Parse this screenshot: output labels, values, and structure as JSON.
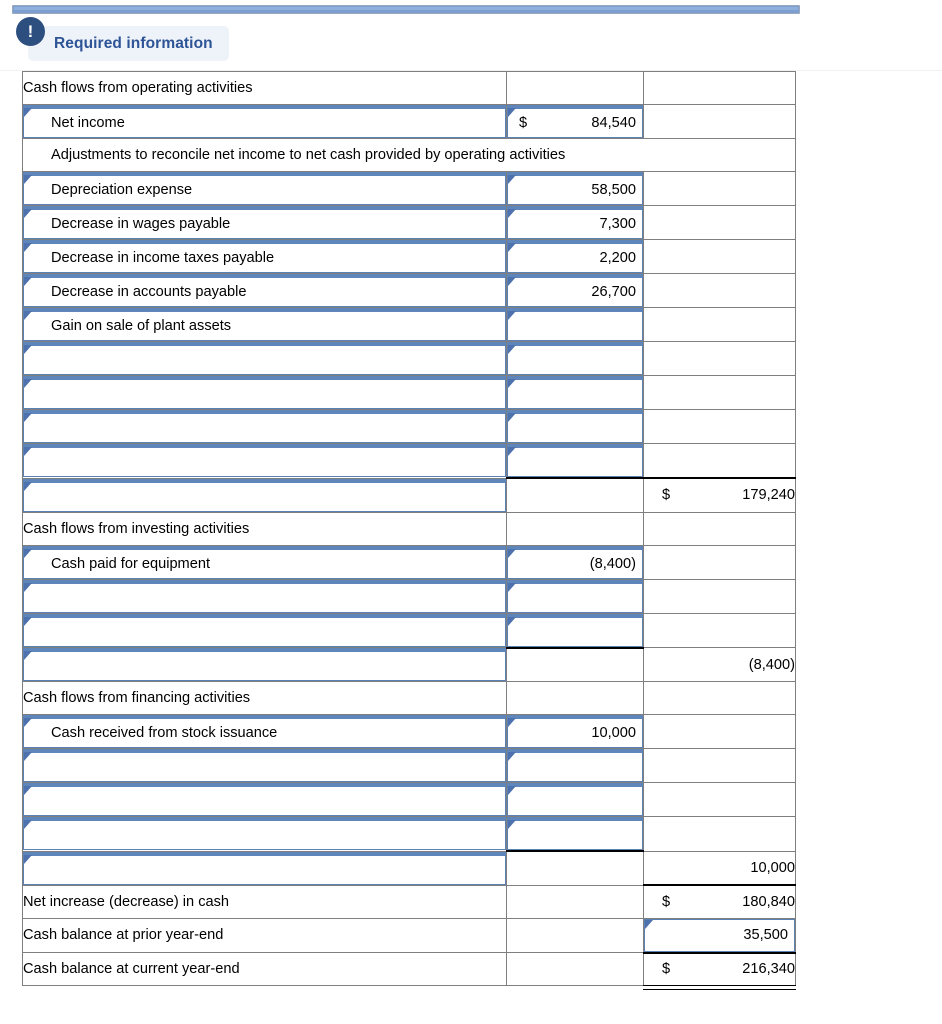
{
  "banner": {
    "icon": "exclamation-icon",
    "label": "Required information"
  },
  "statement": {
    "rows": [
      {
        "type": "section",
        "label": "Cash flows from operating activities",
        "mid": "",
        "right": ""
      },
      {
        "type": "dropdown",
        "label": "Net income",
        "mid": "84,540",
        "mid_dollar": "$",
        "mid_kind": "input",
        "right": ""
      },
      {
        "type": "fullspan",
        "label": "Adjustments to reconcile net income to net cash provided by operating activities"
      },
      {
        "type": "dropdown",
        "label": "Depreciation expense",
        "mid": "58,500",
        "mid_kind": "input",
        "right": ""
      },
      {
        "type": "dropdown",
        "label": "Decrease in wages payable",
        "mid": "7,300",
        "mid_kind": "input",
        "right": ""
      },
      {
        "type": "dropdown",
        "label": "Decrease in income taxes payable",
        "mid": "2,200",
        "mid_kind": "input",
        "right": ""
      },
      {
        "type": "dropdown",
        "label": "Decrease in accounts payable",
        "mid": "26,700",
        "mid_kind": "input",
        "right": ""
      },
      {
        "type": "dropdown",
        "label": "Gain on sale of plant assets",
        "mid": "",
        "mid_kind": "input",
        "right": ""
      },
      {
        "type": "dropdown",
        "label": "",
        "mid": "",
        "mid_kind": "input",
        "right": ""
      },
      {
        "type": "dropdown",
        "label": "",
        "mid": "",
        "mid_kind": "input",
        "right": ""
      },
      {
        "type": "dropdown",
        "label": "",
        "mid": "",
        "mid_kind": "input",
        "right": ""
      },
      {
        "type": "dropdown",
        "label": "",
        "mid": "",
        "mid_kind": "input",
        "right": ""
      },
      {
        "type": "subtotal",
        "label": "",
        "mid": "",
        "right": "179,240",
        "right_dollar": "$"
      },
      {
        "type": "section",
        "label": "Cash flows from investing activities",
        "mid": "",
        "right": ""
      },
      {
        "type": "dropdown",
        "label": "Cash paid for equipment",
        "mid": "(8,400)",
        "mid_kind": "input",
        "right": ""
      },
      {
        "type": "dropdown",
        "label": "",
        "mid": "",
        "mid_kind": "input",
        "right": ""
      },
      {
        "type": "dropdown",
        "label": "",
        "mid": "",
        "mid_kind": "input",
        "right": ""
      },
      {
        "type": "subtotal",
        "label": "",
        "mid": "",
        "right": "(8,400)",
        "right_dollar": ""
      },
      {
        "type": "section",
        "label": "Cash flows from financing activities",
        "mid": "",
        "right": ""
      },
      {
        "type": "dropdown",
        "label": "Cash received from stock issuance",
        "mid": "10,000",
        "mid_kind": "input",
        "right": ""
      },
      {
        "type": "dropdown",
        "label": "",
        "mid": "",
        "mid_kind": "input",
        "right": ""
      },
      {
        "type": "dropdown",
        "label": "",
        "mid": "",
        "mid_kind": "input",
        "right": ""
      },
      {
        "type": "dropdown",
        "label": "",
        "mid": "",
        "mid_kind": "input",
        "right": ""
      },
      {
        "type": "subtotal",
        "label": "",
        "mid": "",
        "right": "10,000",
        "right_dollar": ""
      },
      {
        "type": "total",
        "label": "Net increase (decrease) in cash",
        "mid": "",
        "right": "180,840",
        "right_dollar": "$"
      },
      {
        "type": "rightinput",
        "label": "Cash balance at prior year-end",
        "mid": "",
        "right": "35,500",
        "right_dollar": ""
      },
      {
        "type": "grandtotal",
        "label": "Cash balance at current year-end",
        "mid": "",
        "right": "216,340",
        "right_dollar": "$"
      }
    ]
  },
  "labels": {
    "r0_label": "Cash flows from operating activities",
    "r1_label": "Net income",
    "r1_mid_dollar": "$",
    "r1_mid": "84,540",
    "r2_label": "Adjustments to reconcile net income to net cash provided by operating activities",
    "r3_label": "Depreciation expense",
    "r3_mid": "58,500",
    "r4_label": "Decrease in wages payable",
    "r4_mid": "7,300",
    "r5_label": "Decrease in income taxes payable",
    "r5_mid": "2,200",
    "r6_label": "Decrease in accounts payable",
    "r6_mid": "26,700",
    "r7_label": "Gain on sale of plant assets",
    "r7_mid": "",
    "r8_label": "",
    "r8_mid": "",
    "r9_label": "",
    "r9_mid": "",
    "r10_label": "",
    "r10_mid": "",
    "r11_label": "",
    "r11_mid": "",
    "r12_right_dollar": "$",
    "r12_right": "179,240",
    "r13_label": "Cash flows from investing activities",
    "r14_label": "Cash paid for equipment",
    "r14_mid": "(8,400)",
    "r15_label": "",
    "r15_mid": "",
    "r16_label": "",
    "r16_mid": "",
    "r17_right": "(8,400)",
    "r18_label": "Cash flows from financing activities",
    "r19_label": "Cash received from stock issuance",
    "r19_mid": "10,000",
    "r20_label": "",
    "r20_mid": "",
    "r21_label": "",
    "r21_mid": "",
    "r22_label": "",
    "r22_mid": "",
    "r23_right": "10,000",
    "r24_label": "Net increase (decrease) in cash",
    "r24_right_dollar": "$",
    "r24_right": "180,840",
    "r25_label": "Cash balance at prior year-end",
    "r25_right": "35,500",
    "r26_label": "Cash balance at current year-end",
    "r26_right_dollar": "$",
    "r26_right": "216,340"
  },
  "colors": {
    "accent_blue": "#5b81b5",
    "banner_text": "#2d5496",
    "banner_bg": "#eef2f9",
    "icon_bg": "#2d4f80",
    "grid": "#7f7f7f",
    "topbar": "#7d9fd0"
  }
}
